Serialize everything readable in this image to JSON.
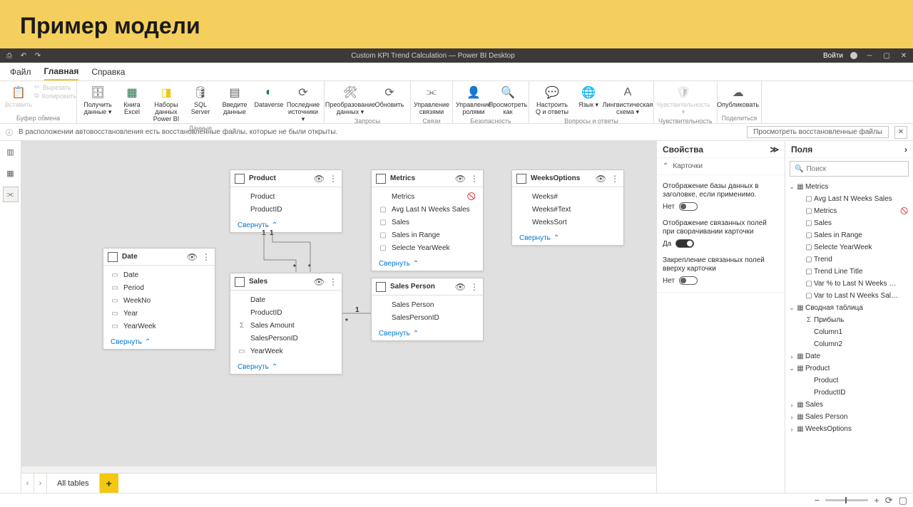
{
  "slide_title": "Пример модели",
  "titlebar": {
    "title": "Custom KPI Trend Calculation — Power BI Desktop",
    "signin": "Войти"
  },
  "menu": {
    "file": "Файл",
    "home": "Главная",
    "help": "Справка"
  },
  "ribbon": {
    "clipboard": {
      "paste": "Вставить",
      "cut": "Вырезать",
      "copy": "Копировать",
      "group": "Буфер обмена"
    },
    "data": {
      "get": "Получить данные ▾",
      "excel": "Книга Excel",
      "pbi": "Наборы данных Power BI",
      "sql": "SQL Server",
      "enter": "Введите данные",
      "dataverse": "Dataverse",
      "recent": "Последние источники ▾",
      "group": "Данные"
    },
    "queries": {
      "transform": "Преобразование данных ▾",
      "refresh": "Обновить",
      "group": "Запросы"
    },
    "relations": {
      "manage": "Управление связями",
      "group": "Связи"
    },
    "security": {
      "roles": "Управление ролями",
      "viewas": "Просмотреть как",
      "group": "Безопасность"
    },
    "qa": {
      "setup": "Настроить Q и ответы",
      "lang": "Язык ▾",
      "ling": "Лингвистическая схема ▾",
      "group": "Вопросы и ответы"
    },
    "sens": {
      "label": "Чувствительность ▾",
      "group": "Чувствительность"
    },
    "share": {
      "publish": "Опубликовать",
      "group": "Поделиться"
    }
  },
  "infobar": {
    "msg": "В расположении автовосстановления есть восстановленные файлы, которые не были открыты.",
    "btn": "Просмотреть восстановленные файлы"
  },
  "tables": {
    "date": {
      "title": "Date",
      "fields": [
        "Date",
        "Period",
        "WeekNo",
        "Year",
        "YearWeek"
      ]
    },
    "product": {
      "title": "Product",
      "fields": [
        "Product",
        "ProductID"
      ]
    },
    "metrics": {
      "title": "Metrics",
      "fields": [
        "Metrics",
        "Avg Last N Weeks Sales",
        "Sales",
        "Sales in Range",
        "Selecte YearWeek"
      ]
    },
    "weeks": {
      "title": "WeeksOptions",
      "fields": [
        "Weeks#",
        "Weeks#Text",
        "WeeksSort"
      ]
    },
    "sales": {
      "title": "Sales",
      "fields": [
        "Date",
        "ProductID",
        "Sales Amount",
        "SalesPersonID",
        "YearWeek"
      ]
    },
    "person": {
      "title": "Sales Person",
      "fields": [
        "Sales Person",
        "SalesPersonID"
      ]
    },
    "collapse": "Свернуть"
  },
  "props": {
    "title": "Свойства",
    "cards": "Карточки",
    "p1": "Отображение базы данных в заголовке, если применимо.",
    "p1v": "Нет",
    "p2": "Отображение связанных полей при сворачивании карточки",
    "p2v": "Да",
    "p3": "Закрепление связанных полей вверху карточки",
    "p3v": "Нет"
  },
  "fields": {
    "title": "Поля",
    "search_ph": "Поиск",
    "metrics": {
      "name": "Metrics",
      "items": [
        "Avg Last N Weeks Sales",
        "Metrics",
        "Sales",
        "Sales in Range",
        "Selecte YearWeek",
        "Trend",
        "Trend Line Title",
        "Var % to Last N Weeks Sales Avg",
        "Var to Last N Weeks Sales Avg"
      ]
    },
    "pivot": {
      "name": "Сводная таблица",
      "items": [
        "Прибыль",
        "Column1",
        "Column2"
      ]
    },
    "rest": [
      "Date",
      "Product",
      "Sales",
      "Sales Person",
      "WeeksOptions"
    ],
    "product_children": [
      "Product",
      "ProductID"
    ]
  },
  "tabs": {
    "all": "All tables"
  }
}
